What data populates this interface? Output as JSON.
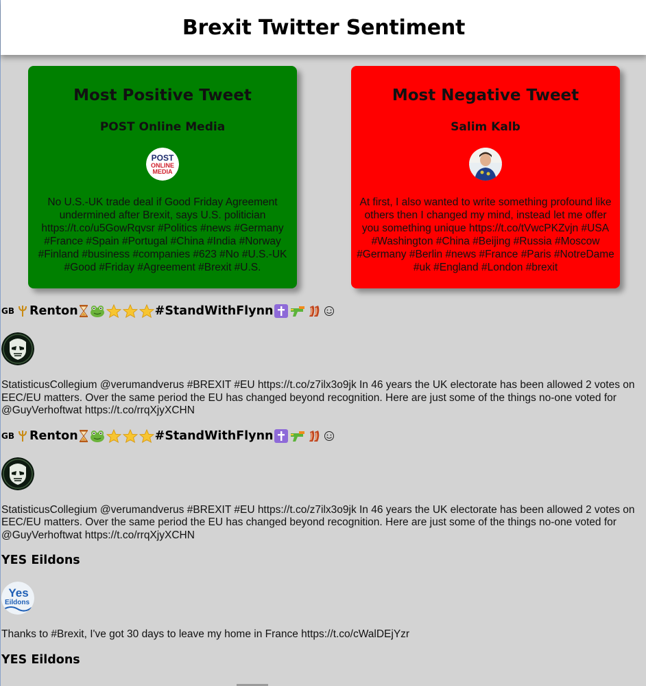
{
  "header": {
    "title": "Brexit Twitter Sentiment"
  },
  "positive": {
    "heading": "Most Positive Tweet",
    "user": "POST Online Media",
    "avatar_lines": [
      "POST",
      "ONLINE",
      "MEDIA"
    ],
    "text": "No U.S.-UK trade deal if Good Friday Agreement undermined after Brexit, says U.S. politician https://t.co/u5GowRqvsr #Politics #news #Germany #France #Spain #Portugal #China #India #Norway #Finland #business #companies #623 #No #U.S.-UK #Good #Friday #Agreement #Brexit #U.S.",
    "color": "#008000"
  },
  "negative": {
    "heading": "Most Negative Tweet",
    "user": "Salim Kalb",
    "text": "At first, I also wanted to write something profound like others then I changed my mind, instead let me offer you something unique https://t.co/tVwcPKZvjn #USA #Washington #China #Beijing #Russia #Moscow #Germany #Berlin #news #France #Paris #NotreDame #uk #England #London #brexit",
    "color": "#ff0000"
  },
  "feed": [
    {
      "flag": "GB",
      "name": "Renton",
      "hashtag": "#StandWithFlynn",
      "text": "StatisticusCollegium @verumandverus #BREXIT #EU https://t.co/z7ilx3o9jk In 46 years the UK electorate has been allowed 2 votes on EEC/EU matters. Over the same period the EU has changed beyond recognition. Here are just some of the things no-one voted for @GuyVerhoftwat https://t.co/rrqXjyXCHN"
    },
    {
      "flag": "GB",
      "name": "Renton",
      "hashtag": "#StandWithFlynn",
      "text": "StatisticusCollegium @verumandverus #BREXIT #EU https://t.co/z7ilx3o9jk In 46 years the UK electorate has been allowed 2 votes on EEC/EU matters. Over the same period the EU has changed beyond recognition. Here are just some of the things no-one voted for @GuyVerhoftwat https://t.co/rrqXjyXCHN"
    },
    {
      "name": "YES Eildons",
      "avatar_lines": [
        "Yes",
        "Eildons"
      ],
      "text": "Thanks to #Brexit, I've got 30 days to leave my home in France https://t.co/cWalDEjYzr"
    },
    {
      "name": "YES Eildons"
    }
  ],
  "colors": {
    "background": "#d3d3d3",
    "header": "#ffffff"
  },
  "icons": [
    "trident-icon",
    "hourglass-icon",
    "frog-icon",
    "star-icon",
    "cross-icon",
    "water-gun-icon",
    "bacon-icon",
    "smiley-icon"
  ]
}
